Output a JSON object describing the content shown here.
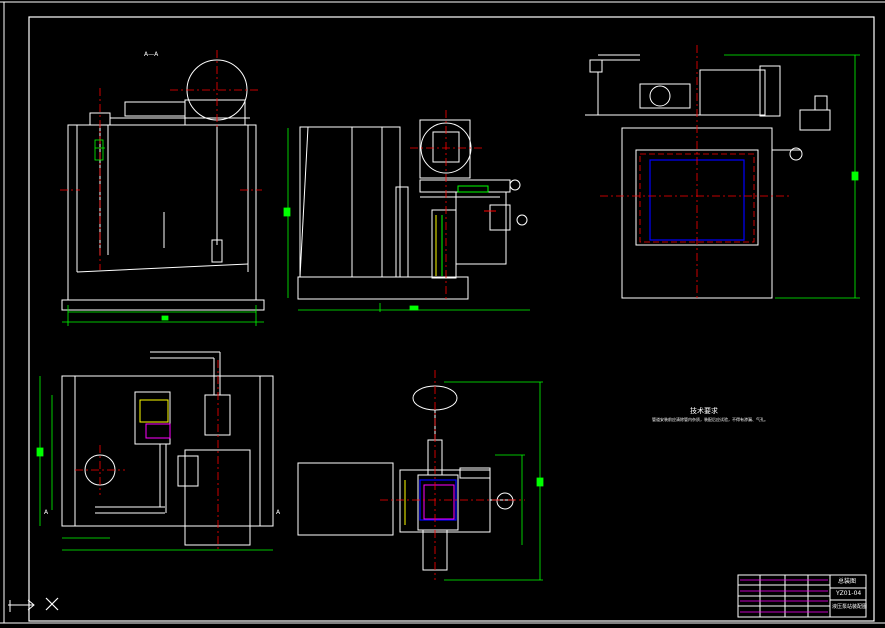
{
  "drawing": {
    "top_label": "A—A",
    "tech_title": "技术要求",
    "tech_note": "管道安装前应清除管内杂质，装配后应试验，不得有渗漏、气孔。",
    "section_mark_a": "A",
    "section_mark_b": "A"
  },
  "title_block": {
    "drawing_name": "总装图",
    "drawing_code": "YZ01-04",
    "company": "液压泵站装配图"
  },
  "colors": {
    "background": "#000000",
    "line": "#ffffff",
    "center_line": "#ff0000",
    "dimension": "#00ff00",
    "hidden": "#0000ff",
    "accent": "#ff00ff",
    "highlight": "#ffff00"
  },
  "icons": {
    "ucs": "ucs-axis-icon",
    "cross": "x-axis-icon"
  }
}
